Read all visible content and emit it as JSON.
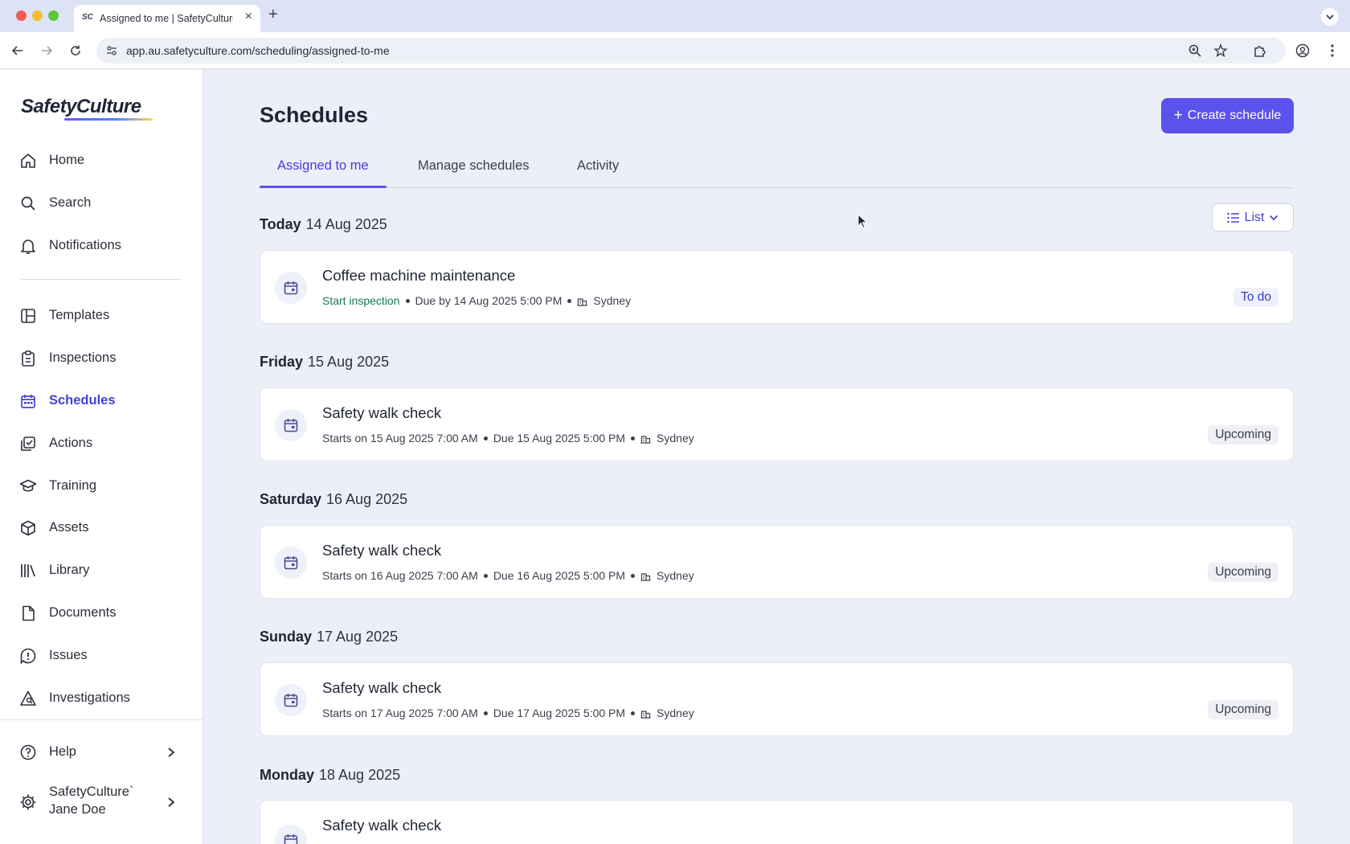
{
  "browser": {
    "tab_title": "Assigned to me | SafetyCulture",
    "tab_favicon": "SC",
    "url": "app.au.safetyculture.com/scheduling/assigned-to-me"
  },
  "sidebar": {
    "logo": "SafetyCulture",
    "items": [
      {
        "label": "Home",
        "icon": "home-icon"
      },
      {
        "label": "Search",
        "icon": "search-icon"
      },
      {
        "label": "Notifications",
        "icon": "bell-icon"
      },
      {
        "label": "Templates",
        "icon": "templates-icon"
      },
      {
        "label": "Inspections",
        "icon": "clipboard-icon"
      },
      {
        "label": "Schedules",
        "icon": "calendar-icon",
        "active": true
      },
      {
        "label": "Actions",
        "icon": "actions-icon"
      },
      {
        "label": "Training",
        "icon": "graduation-cap-icon"
      },
      {
        "label": "Assets",
        "icon": "cube-icon"
      },
      {
        "label": "Library",
        "icon": "library-icon"
      },
      {
        "label": "Documents",
        "icon": "document-icon"
      },
      {
        "label": "Issues",
        "icon": "issue-icon"
      },
      {
        "label": "Investigations",
        "icon": "investigation-icon"
      }
    ],
    "help_label": "Help",
    "org_name": "SafetyCulture`",
    "user_name": "Jane Doe"
  },
  "main": {
    "title": "Schedules",
    "create_button": "Create schedule",
    "tabs": [
      {
        "label": "Assigned to me",
        "active": true
      },
      {
        "label": "Manage schedules"
      },
      {
        "label": "Activity"
      }
    ],
    "view_select": "List",
    "days": [
      {
        "day": "Today",
        "date": "14 Aug 2025",
        "card": {
          "title": "Coffee machine maintenance",
          "start_link": "Start inspection",
          "timing": "Due by 14 Aug 2025 5:00 PM",
          "site": "Sydney",
          "status": "To do"
        }
      },
      {
        "day": "Friday",
        "date": "15 Aug 2025",
        "card": {
          "title": "Safety walk check",
          "starts": "Starts on 15 Aug 2025 7:00 AM",
          "timing": "Due 15 Aug 2025 5:00 PM",
          "site": "Sydney",
          "status": "Upcoming"
        }
      },
      {
        "day": "Saturday",
        "date": "16 Aug 2025",
        "card": {
          "title": "Safety walk check",
          "starts": "Starts on 16 Aug 2025 7:00 AM",
          "timing": "Due 16 Aug 2025 5:00 PM",
          "site": "Sydney",
          "status": "Upcoming"
        }
      },
      {
        "day": "Sunday",
        "date": "17 Aug 2025",
        "card": {
          "title": "Safety walk check",
          "starts": "Starts on 17 Aug 2025 7:00 AM",
          "timing": "Due 17 Aug 2025 5:00 PM",
          "site": "Sydney",
          "status": "Upcoming"
        }
      },
      {
        "day": "Monday",
        "date": "18 Aug 2025",
        "card": {
          "title": "Safety walk check"
        }
      }
    ]
  },
  "colors": {
    "accent": "#5b52ed",
    "active_text": "#4740d4",
    "start_link": "#127a55",
    "page_bg": "#eceef8"
  }
}
